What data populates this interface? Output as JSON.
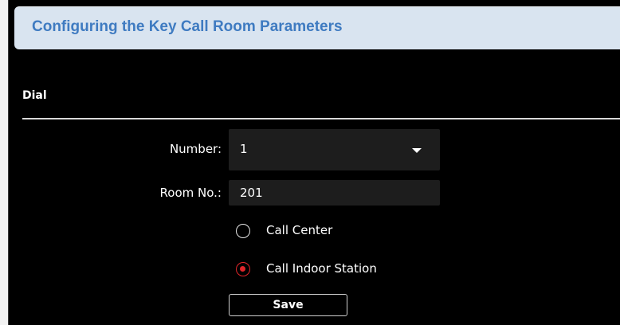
{
  "colors": {
    "panel_bg": "#000000",
    "title_bar_bg": "#d9e4f0",
    "title_text": "#3f7bc1",
    "field_bg": "#1d1d1d",
    "radio_selected": "#e0262a"
  },
  "header": {
    "title": "Configuring the Key Call Room Parameters"
  },
  "section": {
    "title": "Dial"
  },
  "form": {
    "number_label": "Number:",
    "number_value": "1",
    "room_label": "Room No.:",
    "room_value": "201",
    "options": [
      {
        "label": "Call Center",
        "selected": false
      },
      {
        "label": "Call Indoor Station",
        "selected": true
      }
    ],
    "save_label": "Save"
  },
  "icons": {
    "dropdown": "chevron-down-icon"
  }
}
